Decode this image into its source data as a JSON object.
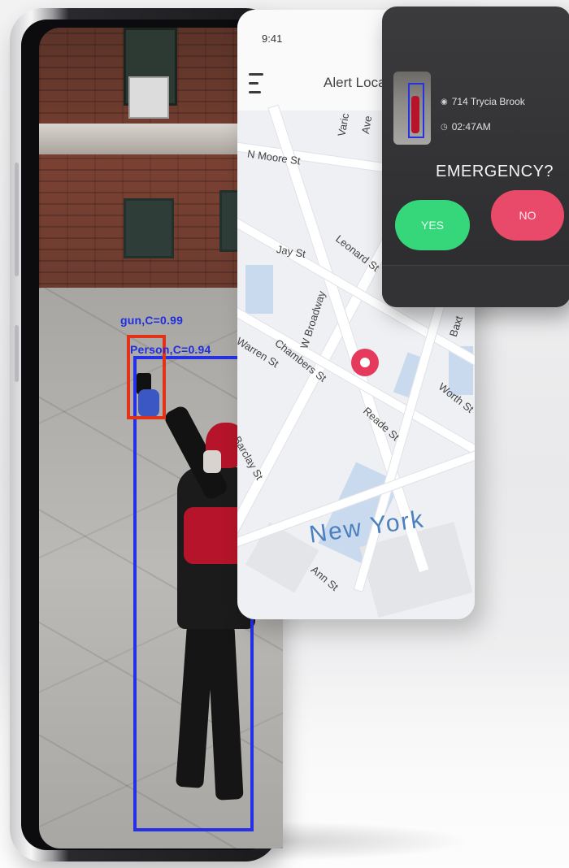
{
  "detection": {
    "gun_label": "gun,C=0.99",
    "person_label": "Person,C=0.94",
    "gun_box_color": "#e23218",
    "person_box_color": "#2631e6"
  },
  "map_screen": {
    "status_time": "9:41",
    "header_title": "Alert Locati",
    "menu_icon": "hamburger-menu-icon",
    "pin_icon": "location-pin-icon",
    "pin_color": "#e53a5b",
    "streets": [
      "N Moore St",
      "Jay St",
      "Leonard St",
      "W Broadway",
      "Chambers St",
      "Warren St",
      "Reade St",
      "Worth St",
      "Barclay St",
      "Ann St",
      "Baxt",
      "Varic",
      "Ave"
    ],
    "city": "New York"
  },
  "alert": {
    "location": "714 Trycia Brook",
    "time": "02:47AM",
    "question": "EMERGENCY?",
    "yes_label": "YES",
    "no_label": "NO",
    "yes_color": "#36d67a",
    "no_color": "#ea4a6a",
    "location_icon": "location-icon",
    "clock_icon": "clock-icon"
  }
}
